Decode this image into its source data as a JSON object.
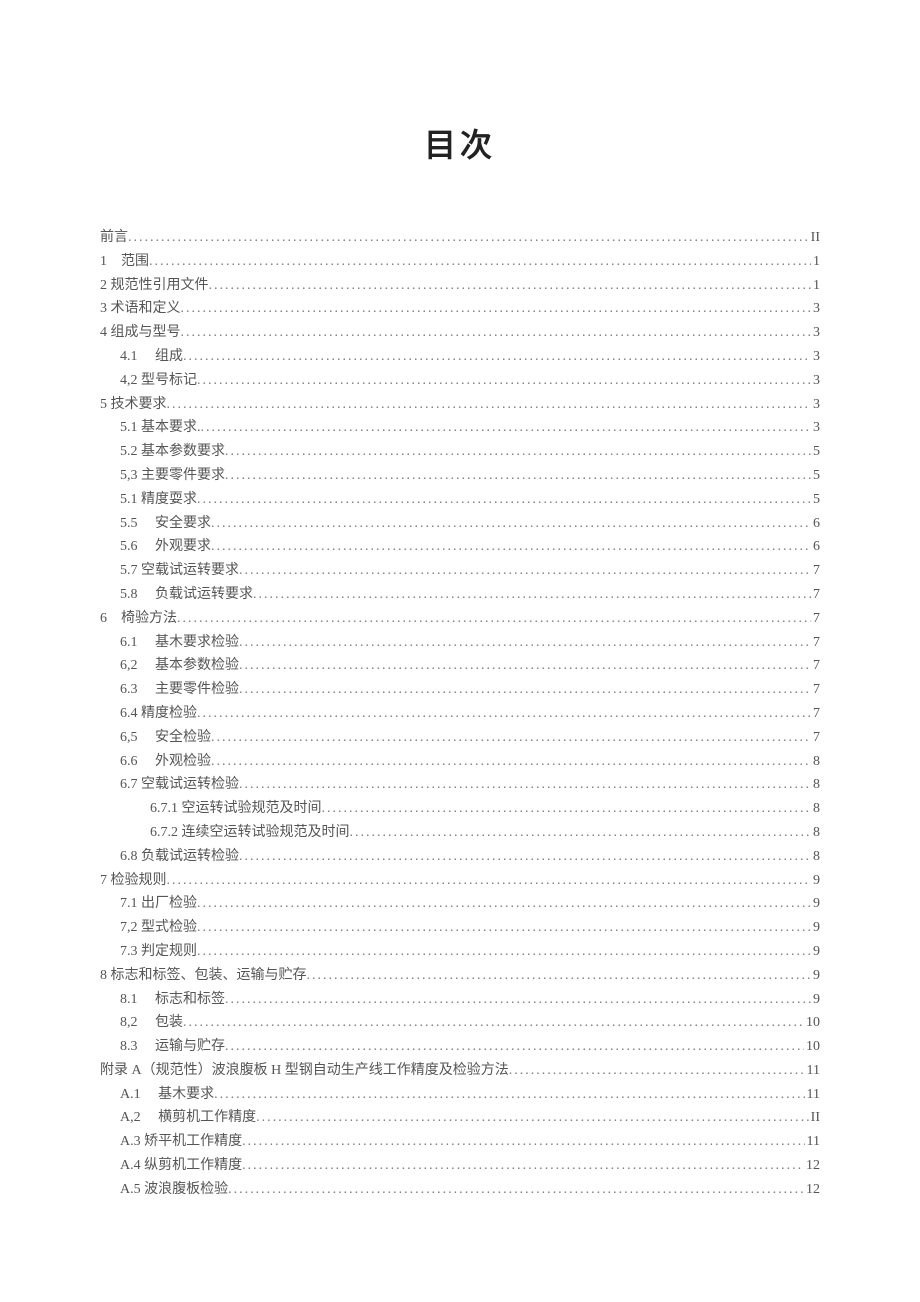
{
  "title": "目次",
  "entries": [
    {
      "label": "前言",
      "page": "II",
      "indent": 0
    },
    {
      "label": "1　范围",
      "page": "1",
      "indent": 0
    },
    {
      "label": "2 规范性引用文件",
      "page": "1",
      "indent": 0
    },
    {
      "label": "3 术语和定义",
      "page": "3",
      "indent": 0
    },
    {
      "label": "4 组成与型号",
      "page": "3",
      "indent": 0
    },
    {
      "label": "4.1　 组成",
      "page": "3",
      "indent": 1
    },
    {
      "label": "4,2 型号标记",
      "page": "3",
      "indent": 1
    },
    {
      "label": "5 技术要求",
      "page": "3",
      "indent": 0
    },
    {
      "label": "5.1 基本要求.",
      "page": "3",
      "indent": 1
    },
    {
      "label": "5.2 基本参数要求",
      "page": "5",
      "indent": 1
    },
    {
      "label": "5,3 主要零件要求",
      "page": "5",
      "indent": 1
    },
    {
      "label": "5.1 精度耍求",
      "page": "5",
      "indent": 1
    },
    {
      "label": "5.5　 安全要求",
      "page": "6",
      "indent": 1
    },
    {
      "label": "5.6　 外观要求",
      "page": "6",
      "indent": 1
    },
    {
      "label": "5.7 空载试运转要求",
      "page": "7",
      "indent": 1
    },
    {
      "label": "5.8　 负载试运转要求",
      "page": "7",
      "indent": 1
    },
    {
      "label": "6　椅验方法",
      "page": "7",
      "indent": 0
    },
    {
      "label": "6.1　 基木要求检验",
      "page": "7",
      "indent": 1
    },
    {
      "label": "6,2　 基本参数检验",
      "page": "7",
      "indent": 1
    },
    {
      "label": "6.3　 主要零件检验",
      "page": "7",
      "indent": 1
    },
    {
      "label": "6.4 精度检验",
      "page": "7",
      "indent": 1
    },
    {
      "label": "6,5　 安全检验",
      "page": "7",
      "indent": 1
    },
    {
      "label": "6.6　 外观检验",
      "page": "8",
      "indent": 1
    },
    {
      "label": "6.7 空载试运转检验",
      "page": "8",
      "indent": 1
    },
    {
      "label": "6.7.1 空运转试验规范及时间",
      "page": "8",
      "indent": 2
    },
    {
      "label": "6.7.2 连续空运转试验规范及时间",
      "page": "8",
      "indent": 2
    },
    {
      "label": "6.8 负载试运转检验",
      "page": "8",
      "indent": 1
    },
    {
      "label": "7 检验规则",
      "page": "9",
      "indent": 0
    },
    {
      "label": "7.1 出厂检验",
      "page": "9",
      "indent": 1
    },
    {
      "label": "7,2 型式检验",
      "page": "9",
      "indent": 1
    },
    {
      "label": "7.3 判定规则",
      "page": "9",
      "indent": 1
    },
    {
      "label": "8 标志和标签、包装、运输与贮存",
      "page": "9",
      "indent": 0
    },
    {
      "label": "8.1　 标志和标签",
      "page": "9",
      "indent": 1
    },
    {
      "label": "8,2　 包装",
      "page": "10",
      "indent": 1
    },
    {
      "label": "8.3　 运输与贮存",
      "page": "10",
      "indent": 1
    },
    {
      "label": "附录 A（规范性）波浪腹板 H 型钢自动生产线工作精度及检验方法",
      "page": "11",
      "indent": 0
    },
    {
      "label": "A.1　 基木要求",
      "page": "11",
      "indent": 1
    },
    {
      "label": "A,2　 横剪机工作精度",
      "page": "II",
      "indent": 1
    },
    {
      "label": "A.3 矫平机工作精度",
      "page": "11",
      "indent": 1
    },
    {
      "label": "A.4 纵剪机工作精度",
      "page": "12",
      "indent": 1
    },
    {
      "label": "A.5 波浪腹板检验",
      "page": "12",
      "indent": 1
    }
  ]
}
